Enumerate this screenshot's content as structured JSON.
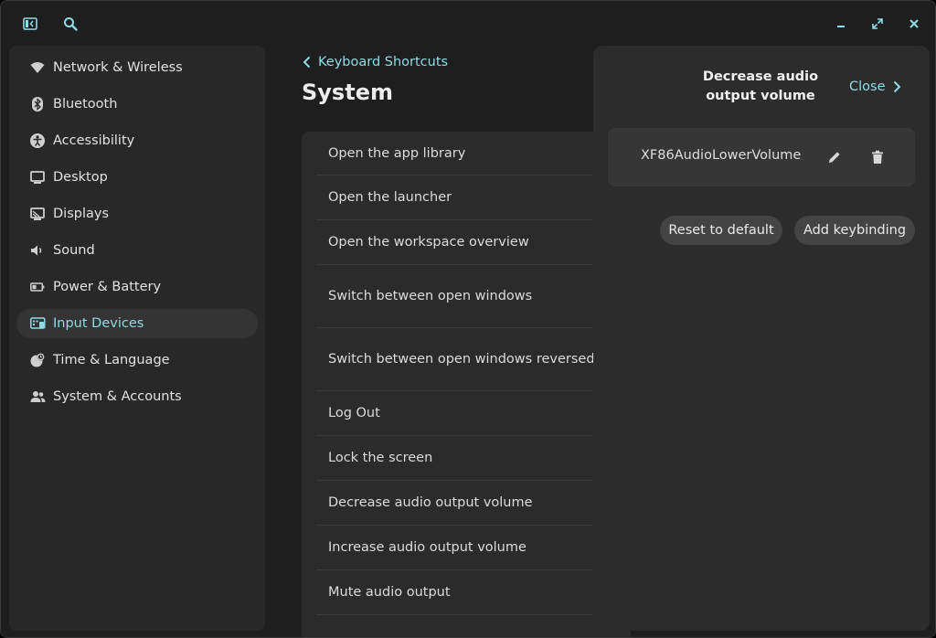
{
  "header": {
    "sidebar_toggle_icon": "sidebar-toggle-icon",
    "search_icon": "search-icon",
    "minimize_icon": "minimize-icon",
    "maximize_icon": "maximize-icon",
    "close_icon": "close-icon"
  },
  "sidebar": {
    "items": [
      {
        "label": "Network & Wireless",
        "icon": "wifi-icon"
      },
      {
        "label": "Bluetooth",
        "icon": "bluetooth-icon"
      },
      {
        "label": "Accessibility",
        "icon": "accessibility-icon"
      },
      {
        "label": "Desktop",
        "icon": "desktop-icon"
      },
      {
        "label": "Displays",
        "icon": "displays-icon"
      },
      {
        "label": "Sound",
        "icon": "speaker-icon"
      },
      {
        "label": "Power & Battery",
        "icon": "battery-icon"
      },
      {
        "label": "Input Devices",
        "icon": "keyboard-icon",
        "active": true
      },
      {
        "label": "Time & Language",
        "icon": "clock-globe-icon"
      },
      {
        "label": "System & Accounts",
        "icon": "users-icon"
      }
    ]
  },
  "main": {
    "back_label": "Keyboard Shortcuts",
    "title": "System",
    "shortcuts": [
      "Open the app library",
      "Open the launcher",
      "Open the workspace overview",
      "Switch between open windows",
      "Switch between open windows reversed",
      "Log Out",
      "Lock the screen",
      "Decrease audio output volume",
      "Increase audio output volume",
      "Mute audio output"
    ]
  },
  "panel": {
    "title": "Decrease audio output volume",
    "close_label": "Close",
    "binding": "XF86AudioLowerVolume",
    "edit_icon": "pencil-icon",
    "delete_icon": "trash-icon",
    "reset_label": "Reset to default",
    "add_label": "Add keybinding"
  },
  "colors": {
    "accent": "#8fdbe6",
    "background": "#1e1e1e",
    "surface": "#2b2b2b"
  }
}
